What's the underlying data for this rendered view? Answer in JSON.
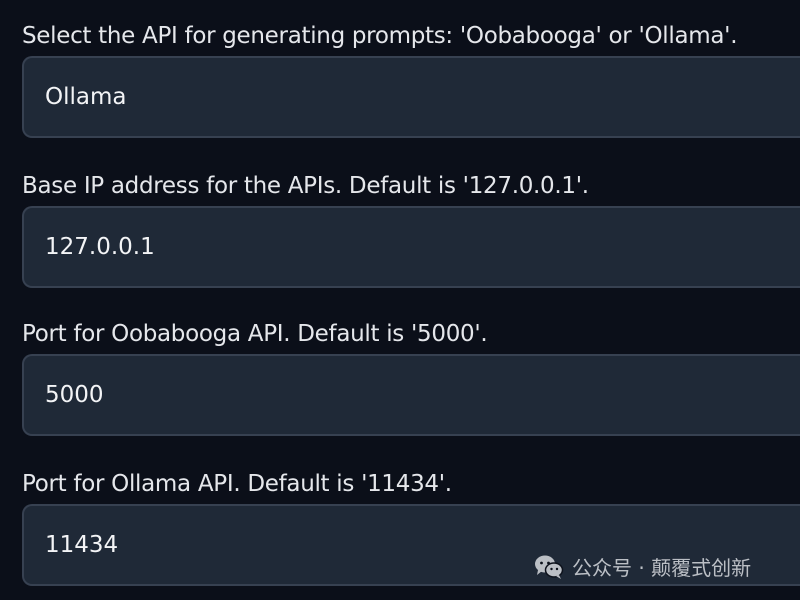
{
  "fields": [
    {
      "label": "Select the API for generating prompts: 'Oobabooga' or 'Ollama'.",
      "value": "Ollama"
    },
    {
      "label": "Base IP address for the APIs. Default is '127.0.0.1'.",
      "value": "127.0.0.1"
    },
    {
      "label": "Port for Oobabooga API. Default is '5000'.",
      "value": "5000"
    },
    {
      "label": "Port for Ollama API. Default is '11434'.",
      "value": "11434"
    }
  ],
  "watermark": {
    "text": "公众号 · 颠覆式创新",
    "icon": "wechat-icon"
  },
  "colors": {
    "background": "#0b0f19",
    "input_background": "#1f2937",
    "input_border": "#374151",
    "text": "#e5e7eb"
  }
}
